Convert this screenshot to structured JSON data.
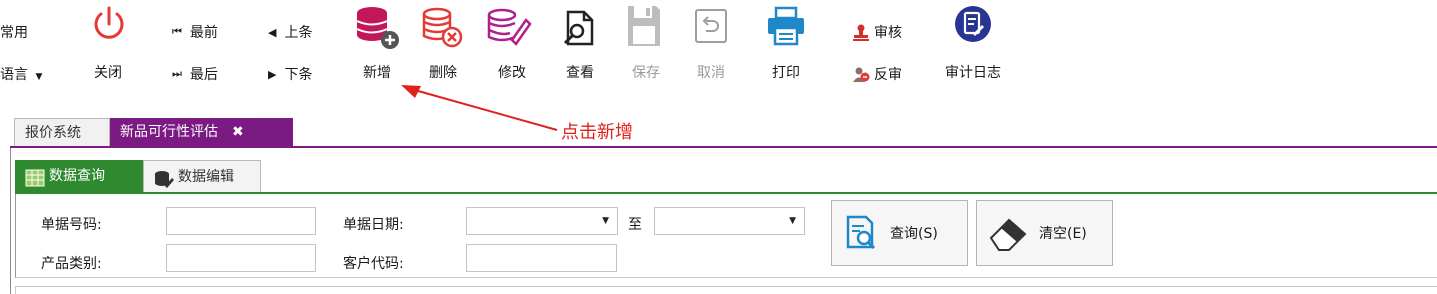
{
  "toolbar": {
    "common_label": "常用",
    "language_label": "语言",
    "close_label": "关闭",
    "first_label": "最前",
    "prev_label": "上条",
    "last_label": "最后",
    "next_label": "下条",
    "add_label": "新增",
    "delete_label": "删除",
    "edit_label": "修改",
    "view_label": "查看",
    "save_label": "保存",
    "cancel_label": "取消",
    "print_label": "打印",
    "approve_label": "审核",
    "unapprove_label": "反审",
    "audit_log_label": "审计日志"
  },
  "tabs": [
    {
      "label": "报价系统",
      "active": false
    },
    {
      "label": "新品可行性评估",
      "active": true,
      "close": "✖"
    }
  ],
  "subtabs": [
    {
      "label": "数据查询",
      "active": true,
      "icon": "table-icon"
    },
    {
      "label": "数据编辑",
      "active": false,
      "icon": "database-edit-icon"
    }
  ],
  "form": {
    "doc_no_label": "单据号码:",
    "doc_no_value": "",
    "doc_date_label": "单据日期:",
    "doc_date_from": "",
    "to_label": "至",
    "doc_date_to": "",
    "category_label": "产品类别:",
    "category_value": "",
    "customer_code_label": "客户代码:",
    "customer_code_value": "",
    "query_button": "查询(S)",
    "clear_button": "清空(E)"
  },
  "annotation": {
    "text": "点击新增",
    "color": "#e0201c"
  },
  "colors": {
    "active_tab": "#7a1a82",
    "active_subtab": "#2f8a2f",
    "add_icon": "#c2185b",
    "delete_icon": "#e53935",
    "edit_icon": "#b01f8a",
    "print_icon": "#1e88c9",
    "audit_icon": "#283593"
  }
}
